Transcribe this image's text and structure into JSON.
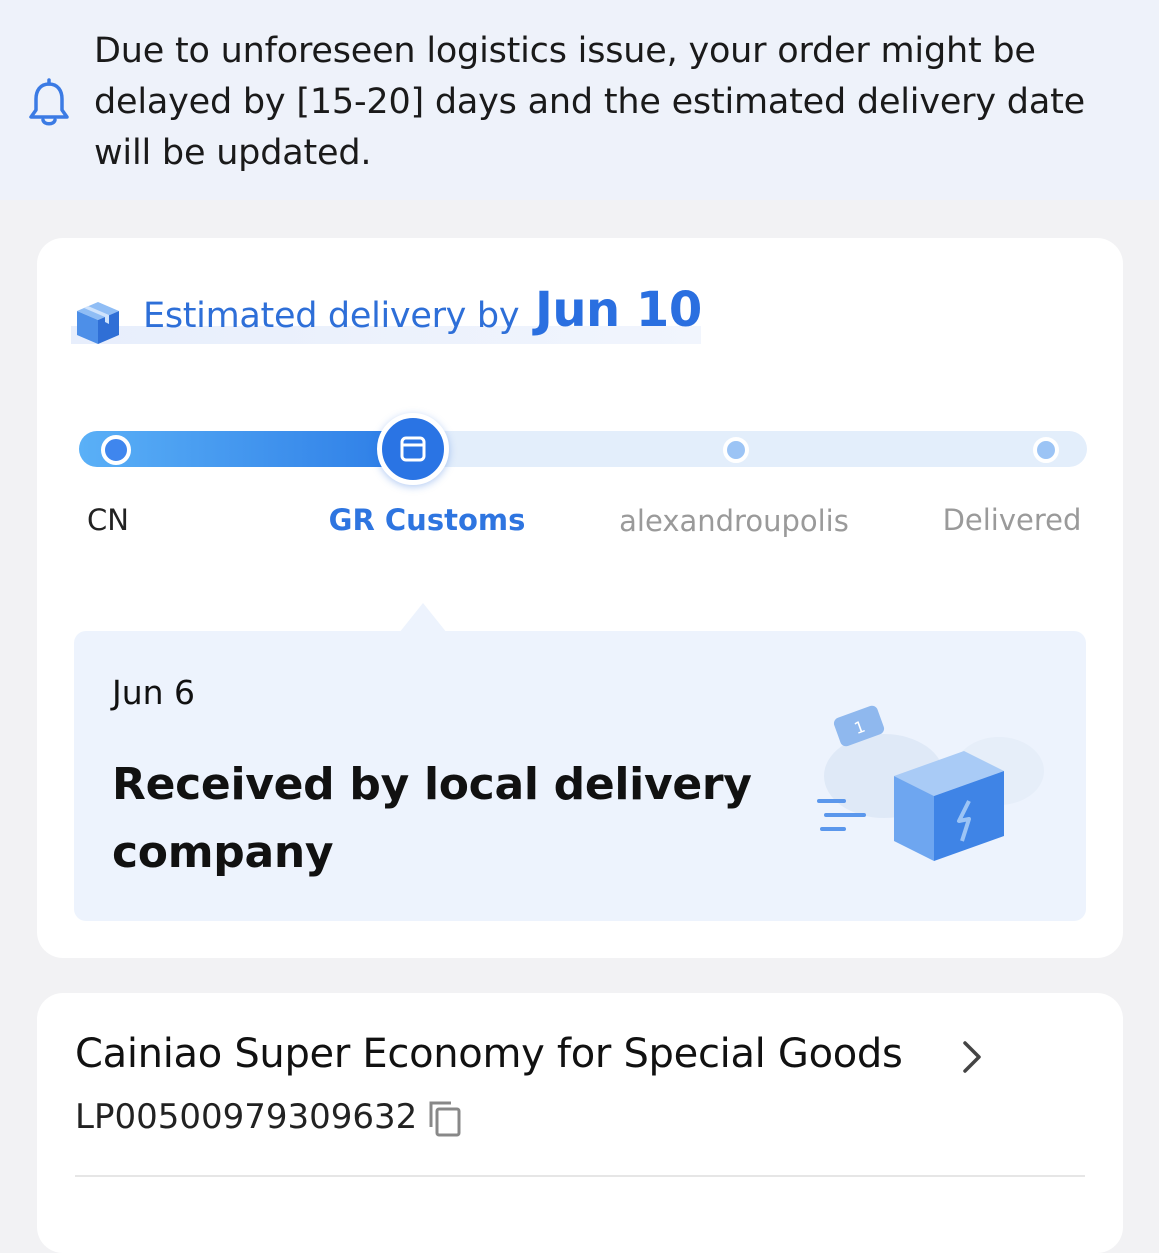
{
  "notice": {
    "text": "Due to unforeseen logistics issue, your order might be delayed by [15-20] days and the estimated delivery date will be updated.",
    "icon": "bell-icon"
  },
  "delivery": {
    "label": "Estimated delivery by",
    "date": "Jun 10",
    "icon": "package-box-icon"
  },
  "progress": {
    "stages": [
      {
        "label": "CN",
        "state": "done"
      },
      {
        "label": "GR Customs",
        "state": "current"
      },
      {
        "label": "alexandroupolis",
        "state": "pending"
      },
      {
        "label": "Delivered",
        "state": "pending"
      }
    ],
    "current_index": 1
  },
  "status": {
    "date": "Jun 6",
    "title": "Received by local delivery company",
    "illustration": "flying-package-illustration"
  },
  "carrier": {
    "name": "Cainiao Super Economy for Special Goods",
    "tracking_number": "LP00500979309632"
  },
  "colors": {
    "accent": "#2a74e4",
    "notice_bg": "#eef2fa",
    "status_bg": "#edf3fd",
    "pending": "#9cc4f5"
  }
}
